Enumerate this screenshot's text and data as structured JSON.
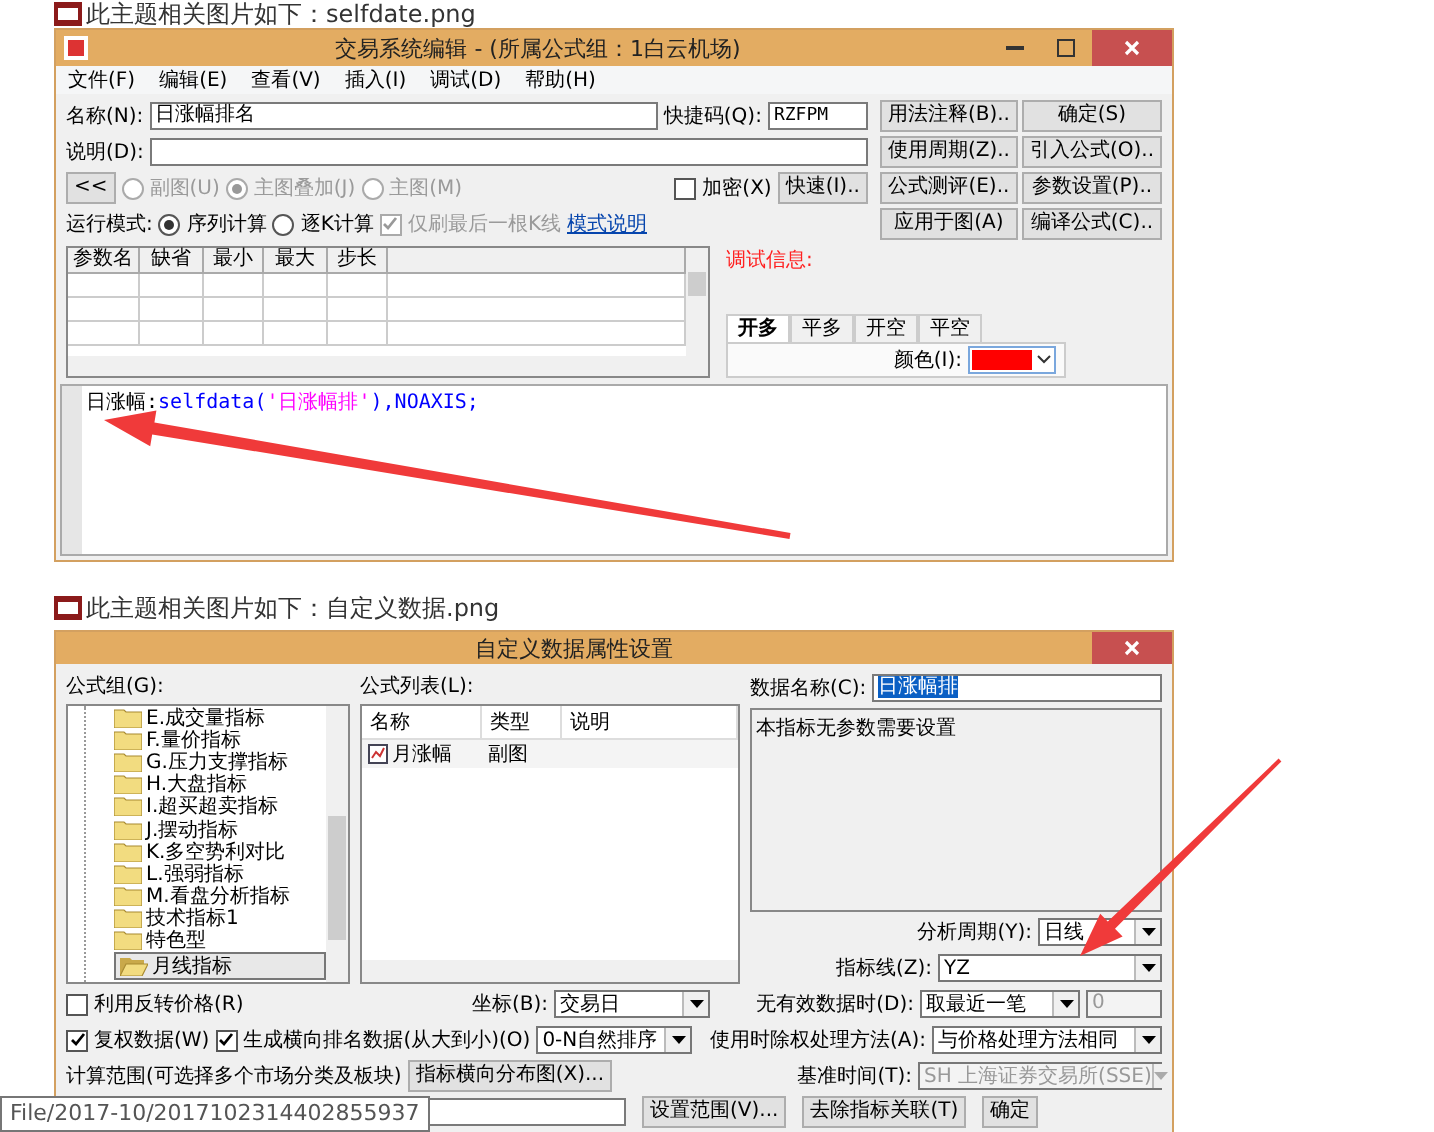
{
  "editor_screenshot": {
    "caption": "此主题相关图片如下：selfdate.png",
    "window": {
      "title": "交易系统编辑 - (所属公式组：1白云机场)",
      "menu": [
        "文件(F)",
        "编辑(E)",
        "查看(V)",
        "插入(I)",
        "调试(D)",
        "帮助(H)"
      ],
      "name": {
        "label": "名称(N):",
        "value": "日涨幅排名"
      },
      "shortcut": {
        "label": "快捷码(Q):",
        "value": "RZFPM"
      },
      "description": {
        "label": "说明(D):"
      },
      "collapse_button": "<<",
      "chart_types": [
        {
          "label": "副图(U)",
          "selected": false,
          "disabled": true
        },
        {
          "label": "主图叠加(J)",
          "selected": true,
          "disabled": true
        },
        {
          "label": "主图(M)",
          "selected": false,
          "disabled": true
        }
      ],
      "encrypt": {
        "label": "加密(X)",
        "checked": false
      },
      "quick_button": "快速(I)..",
      "buttons": [
        "用法注释(B)..",
        "确定(S)",
        "使用周期(Z)..",
        "引入公式(O)..",
        "公式测评(E)..",
        "参数设置(P)..",
        "应用于图(A)",
        "编译公式(C).."
      ],
      "run_mode": {
        "label": "运行模式:",
        "options": [
          {
            "label": "序列计算",
            "selected": true
          },
          {
            "label": "逐K计算",
            "selected": false
          }
        ]
      },
      "refresh_last": {
        "label": "仅刷最后一根K线",
        "checked": true,
        "disabled": true
      },
      "mode_help_link": "模式说明",
      "param_columns": [
        "参数名",
        "缺省",
        "最小",
        "最大",
        "步长"
      ],
      "debug_label": "调试信息:",
      "tabs": [
        {
          "label": "开多",
          "selected": true
        },
        {
          "label": "平多",
          "selected": false
        },
        {
          "label": "开空",
          "selected": false
        },
        {
          "label": "平空",
          "selected": false
        }
      ],
      "color": {
        "label": "颜色(I):",
        "color": "#ff0000"
      },
      "code": [
        {
          "kind": "name",
          "text": "日涨幅:"
        },
        {
          "kind": "function",
          "text": "selfdata("
        },
        {
          "kind": "string",
          "text": "'日涨幅排'"
        },
        {
          "kind": "function",
          "text": "),NOAXIS;"
        }
      ]
    }
  },
  "data_screenshot": {
    "caption": "此主题相关图片如下：自定义数据.png",
    "window": {
      "title": "自定义数据属性设置",
      "group_label": "公式组(G):",
      "groups": [
        {
          "label": "E.成交量指标",
          "selected": false
        },
        {
          "label": "F.量价指标",
          "selected": false
        },
        {
          "label": "G.压力支撑指标",
          "selected": false
        },
        {
          "label": "H.大盘指标",
          "selected": false
        },
        {
          "label": "I.超买超卖指标",
          "selected": false
        },
        {
          "label": "J.摆动指标",
          "selected": false
        },
        {
          "label": "K.多空势利对比",
          "selected": false
        },
        {
          "label": "L.强弱指标",
          "selected": false
        },
        {
          "label": "M.看盘分析指标",
          "selected": false
        },
        {
          "label": "技术指标1",
          "selected": false
        },
        {
          "label": "特色型",
          "selected": false
        },
        {
          "label": "月线指标",
          "selected": true
        }
      ],
      "list_label": "公式列表(L):",
      "list_columns": [
        "名称",
        "类型",
        "说明"
      ],
      "list_rows": [
        {
          "name": "月涨幅",
          "type": "副图"
        }
      ],
      "data_name": {
        "label": "数据名称(C):",
        "value": "日涨幅排"
      },
      "note": "本指标无参数需要设置",
      "analysis_period": {
        "label": "分析周期(Y):",
        "value": "日线"
      },
      "indicator_line": {
        "label": "指标线(Z):",
        "value": "YZ"
      },
      "no_data": {
        "label": "无有效数据时(D):",
        "value": "取最近一笔",
        "count": "0"
      },
      "ex_rights": {
        "label": "使用时除权处理方法(A):",
        "value": "与价格处理方法相同"
      },
      "base_time": {
        "label": "基准时间(T):",
        "value": "SH 上海证券交易所(SSE)",
        "disabled": true
      },
      "reverse_price": {
        "label": "利用反转价格(R)",
        "checked": false
      },
      "axis": {
        "label": "坐标(B):",
        "value": "交易日"
      },
      "adjusted": {
        "label": "复权数据(W)",
        "checked": true
      },
      "ranking": {
        "label": "生成横向排名数据(从大到小)(O)",
        "checked": true
      },
      "sort": {
        "value": "0-N自然排序"
      },
      "range_label": "计算范围(可选择多个市场分类及板块)",
      "distribution_button": "指标横向分布图(X)...",
      "bottom_buttons": [
        "设置范围(V)...",
        "去除指标关联(T)",
        "确定"
      ]
    },
    "tooltip": "File/2017-10/2017102314402855937"
  }
}
